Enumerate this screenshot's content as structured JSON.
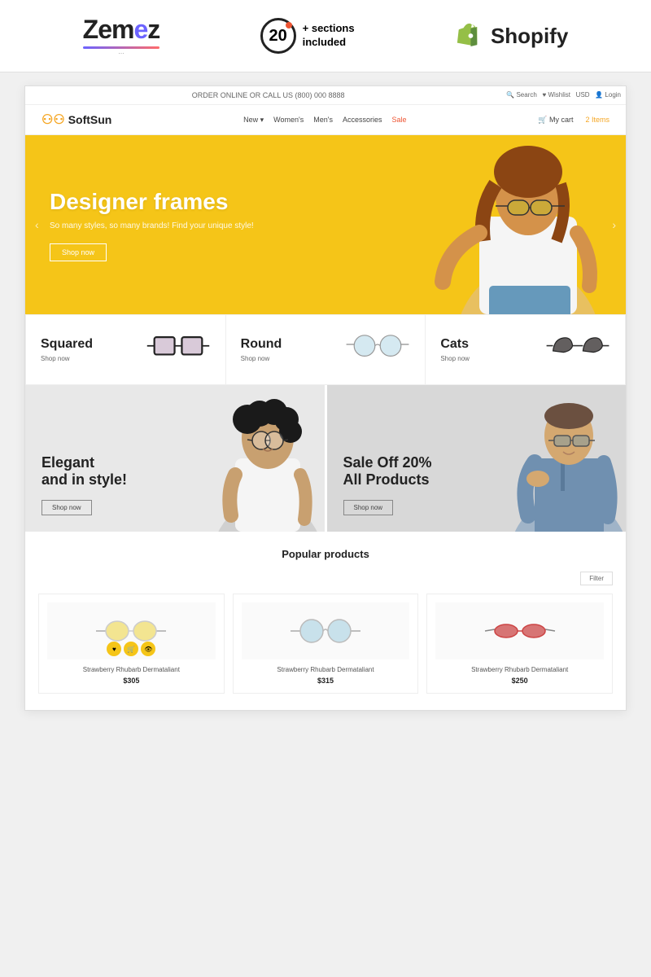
{
  "brandBar": {
    "zemes": {
      "text1": "Zem",
      "text2": "ez",
      "tagline": "Zemes"
    },
    "sections": {
      "number": "20",
      "plus": "+",
      "line1": "sections",
      "line2": "included"
    },
    "shopify": {
      "label": "Shopify"
    }
  },
  "site": {
    "topbar": "ORDER ONLINE OR CALL US (800) 000 8888",
    "logo": "SoftSun",
    "nav": {
      "items": [
        "New ▾",
        "Women's",
        "Men's",
        "Accessories",
        "Sale"
      ],
      "actions": [
        "🔍 Search",
        "♥ Wishlist",
        "USD",
        "👤 Login"
      ],
      "cart": "🛒 My cart  2 Items"
    },
    "hero": {
      "title": "Designer frames",
      "subtitle": "So many styles, so many brands! Find your unique style!",
      "cta": "Shop now",
      "arrowLeft": "‹",
      "arrowRight": "›"
    },
    "categories": [
      {
        "title": "Squared",
        "link": "Shop now",
        "type": "square"
      },
      {
        "title": "Round",
        "link": "Shop now",
        "type": "round"
      },
      {
        "title": "Cats",
        "link": "Shop now",
        "type": "cat"
      }
    ],
    "promos": [
      {
        "title": "Elegant\nand in style!",
        "cta": "Shop now",
        "side": "left"
      },
      {
        "title": "Sale Off 20%\nAll Products",
        "cta": "Shop now",
        "side": "right"
      }
    ],
    "popular": {
      "sectionTitle": "Popular products",
      "filterLabel": "Filter",
      "products": [
        {
          "name": "Strawberry Rhubarb Dermataliant",
          "price": "$305",
          "hasActions": true
        },
        {
          "name": "Strawberry Rhubarb Dermataliant",
          "price": "$315",
          "hasActions": false
        },
        {
          "name": "Strawberry Rhubarb Dermataliant",
          "price": "$250",
          "hasActions": false
        }
      ]
    }
  }
}
